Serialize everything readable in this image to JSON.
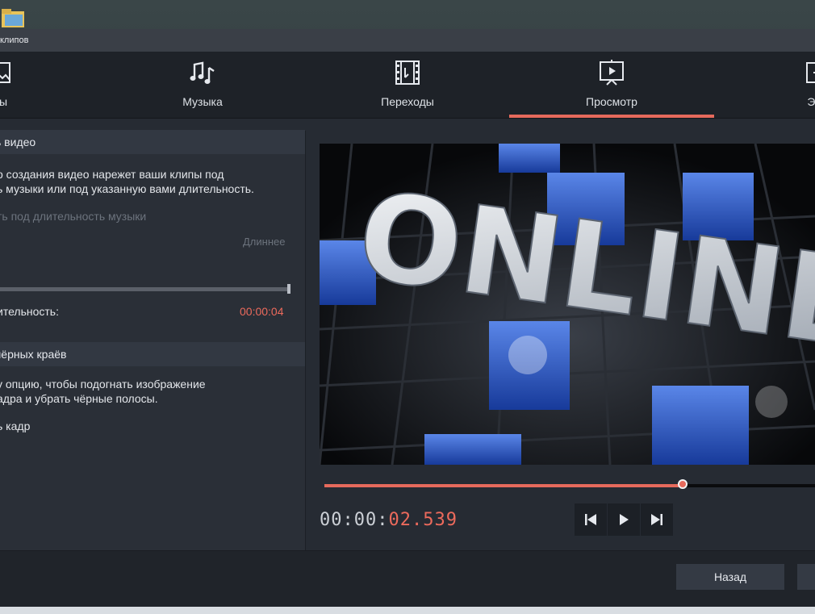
{
  "window": {
    "title_fragment": "клипов"
  },
  "tabs": [
    {
      "label": "лы",
      "icon": "media-icon"
    },
    {
      "label": "Музыка",
      "icon": "music-notes-icon"
    },
    {
      "label": "Переходы",
      "icon": "transition-film-icon"
    },
    {
      "label": "Просмотр",
      "icon": "preview-play-icon",
      "active": true
    },
    {
      "label": "Экс",
      "icon": "export-icon"
    }
  ],
  "left": {
    "section1": {
      "header": "ь видео",
      "desc_line1": "о создания видео нарежет ваши клипы под",
      "desc_line2": "ь музыки или под указанную вами длительность.",
      "option": "ть под длительность музыки",
      "slider_right_label": "Длиннее",
      "duration_label": "ительность:",
      "duration_value": "00:00:04"
    },
    "section2": {
      "header": "чёрных краёв",
      "desc_line1": "у опцию, чтобы подогнать изображение",
      "desc_line2": "адра и убрать чёрные полосы.",
      "option": "ь кадр"
    }
  },
  "preview": {
    "video_text": "ONLINE",
    "progress_fraction": 0.73,
    "timecode_main": "00:00:",
    "timecode_accent": "02.539"
  },
  "bottom": {
    "back_label": "Назад"
  },
  "colors": {
    "accent": "#e66a5c",
    "window_bg": "#262b33",
    "tabbar_bg": "#1e2228"
  }
}
